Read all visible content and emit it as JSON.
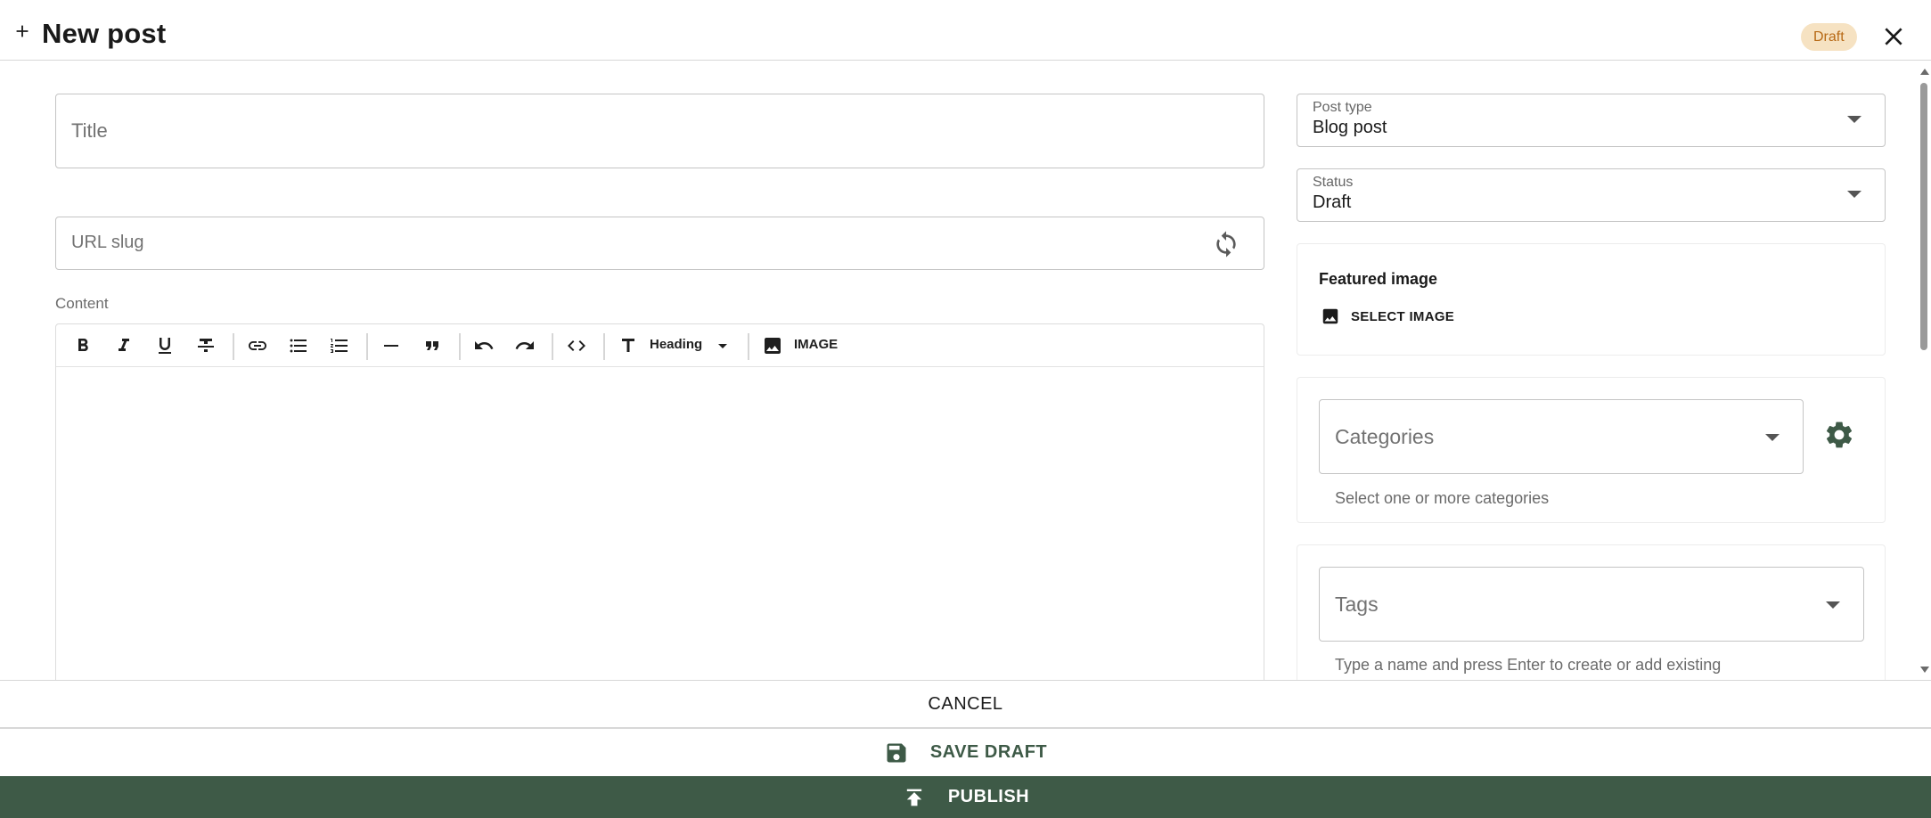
{
  "header": {
    "title": "New post",
    "status_badge": "Draft",
    "badge_bg": "#f6e2c2",
    "badge_color": "#b86a16"
  },
  "form": {
    "title_placeholder": "Title",
    "slug_placeholder": "URL slug",
    "content_label": "Content"
  },
  "toolbar": {
    "heading_label": "Heading",
    "image_label": "IMAGE",
    "icons": [
      "bold-icon",
      "italic-icon",
      "underline-icon",
      "strikethrough-icon",
      "link-icon",
      "bulleted-list-icon",
      "numbered-list-icon",
      "horizontal-rule-icon",
      "quote-icon",
      "undo-icon",
      "redo-icon",
      "code-icon",
      "text-heading-icon",
      "image-icon"
    ]
  },
  "sidebar": {
    "post_type": {
      "label": "Post type",
      "value": "Blog post"
    },
    "status": {
      "label": "Status",
      "value": "Draft"
    },
    "featured_image": {
      "title": "Featured image",
      "button_label": "SELECT IMAGE"
    },
    "categories": {
      "placeholder": "Categories",
      "help": "Select one or more categories"
    },
    "tags": {
      "placeholder": "Tags",
      "help": "Type a name and press Enter to create or add existing"
    }
  },
  "footer": {
    "cancel_label": "CANCEL",
    "save_draft_label": "SAVE DRAFT",
    "publish_label": "PUBLISH",
    "accent": "#3e5a47"
  }
}
